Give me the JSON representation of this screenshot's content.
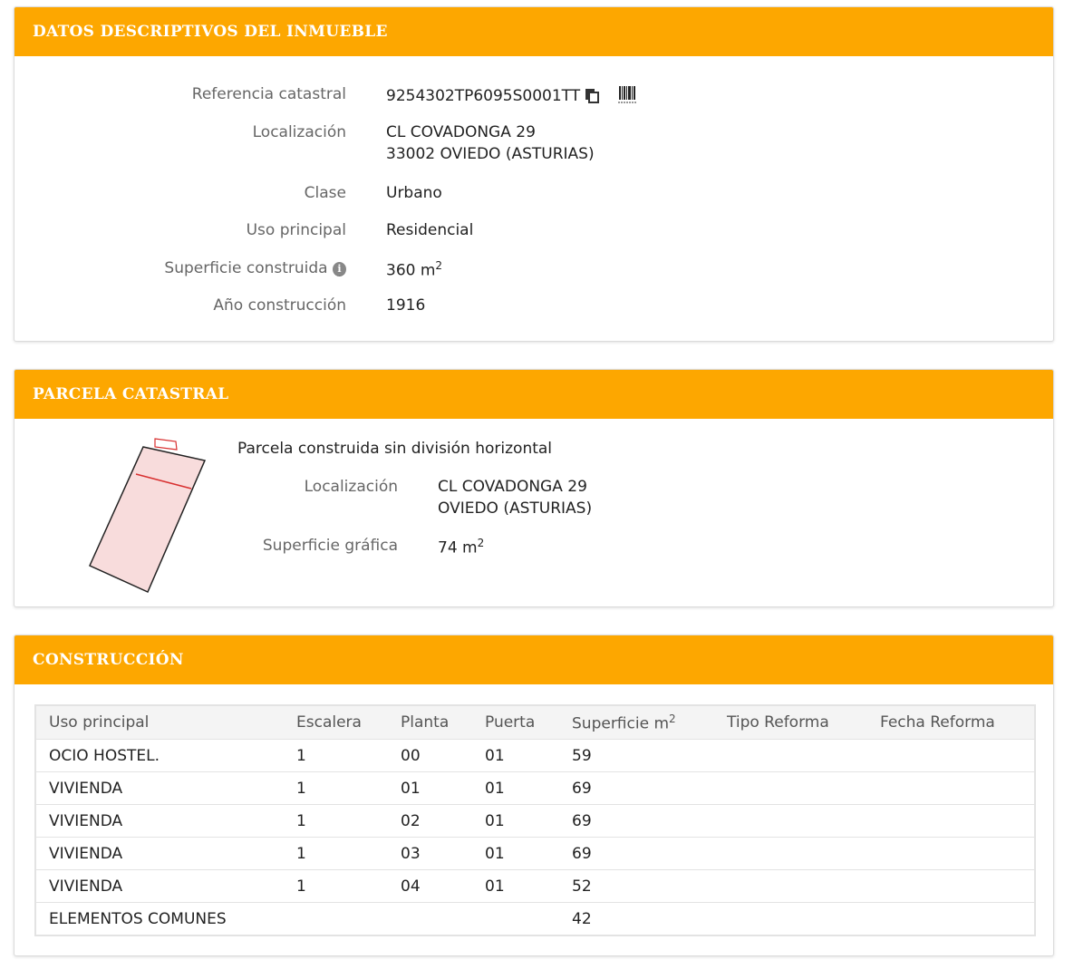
{
  "panel_datos": {
    "title": "DATOS DESCRIPTIVOS DEL INMUEBLE",
    "referencia_label": "Referencia catastral",
    "referencia_value": "9254302TP6095S0001TT",
    "localizacion_label": "Localización",
    "localizacion_line1": "CL COVADONGA 29",
    "localizacion_line2": "33002 OVIEDO (ASTURIAS)",
    "clase_label": "Clase",
    "clase_value": "Urbano",
    "uso_label": "Uso principal",
    "uso_value": "Residencial",
    "superficie_label": "Superficie construida",
    "superficie_value": "360 m",
    "superficie_sup": "2",
    "anio_label": "Año construcción",
    "anio_value": "1916",
    "icons": [
      "copy-icon",
      "barcode-icon",
      "info-icon"
    ]
  },
  "panel_parcela": {
    "title": "PARCELA CATASTRAL",
    "subtitle": "Parcela construida sin división horizontal",
    "localizacion_label": "Localización",
    "localizacion_line1": "CL COVADONGA 29",
    "localizacion_line2": "OVIEDO (ASTURIAS)",
    "superficie_label": "Superficie gráfica",
    "superficie_value": "74 m",
    "superficie_sup": "2"
  },
  "panel_construccion": {
    "title": "CONSTRUCCIÓN",
    "headers": [
      "Uso principal",
      "Escalera",
      "Planta",
      "Puerta",
      "Superficie m",
      "Tipo Reforma",
      "Fecha Reforma"
    ],
    "superficie_header_sup": "2",
    "rows": [
      [
        "OCIO HOSTEL.",
        "1",
        "00",
        "01",
        "59",
        "",
        ""
      ],
      [
        "VIVIENDA",
        "1",
        "01",
        "01",
        "69",
        "",
        ""
      ],
      [
        "VIVIENDA",
        "1",
        "02",
        "01",
        "69",
        "",
        ""
      ],
      [
        "VIVIENDA",
        "1",
        "03",
        "01",
        "69",
        "",
        ""
      ],
      [
        "VIVIENDA",
        "1",
        "04",
        "01",
        "52",
        "",
        ""
      ],
      [
        "ELEMENTOS COMUNES",
        "",
        "",
        "",
        "42",
        "",
        ""
      ]
    ]
  },
  "colors": {
    "header_orange": "#fda700",
    "plot_fill": "#f8dcdc",
    "plot_line": "#d83030"
  }
}
